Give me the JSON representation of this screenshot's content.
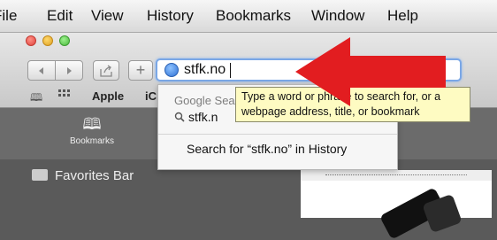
{
  "menubar": {
    "items": [
      "File",
      "Edit",
      "View",
      "History",
      "Bookmarks",
      "Window",
      "Help"
    ]
  },
  "toolbar": {
    "back_icon": "triangle-left",
    "forward_icon": "triangle-right",
    "share_icon": "share",
    "add_icon": "+"
  },
  "address_bar": {
    "value": "stfk.no",
    "icon": "globe-icon"
  },
  "bookmarks_bar": {
    "items": [
      "Apple",
      "iC"
    ]
  },
  "sidebar": {
    "tab_label": "Bookmarks",
    "favorites": "Favorites Bar"
  },
  "dropdown": {
    "header": "Google Sea",
    "suggestion": "stfk.n",
    "history": "Search for “stfk.no” in History"
  },
  "tooltip": {
    "line1": "Type a word or phrase to search for, or a",
    "line2": "webpage address, title, or bookmark"
  },
  "colors": {
    "arrow": "#e21d20",
    "tooltip_bg": "#fefbc2",
    "focus_ring": "#7aa7e6"
  }
}
